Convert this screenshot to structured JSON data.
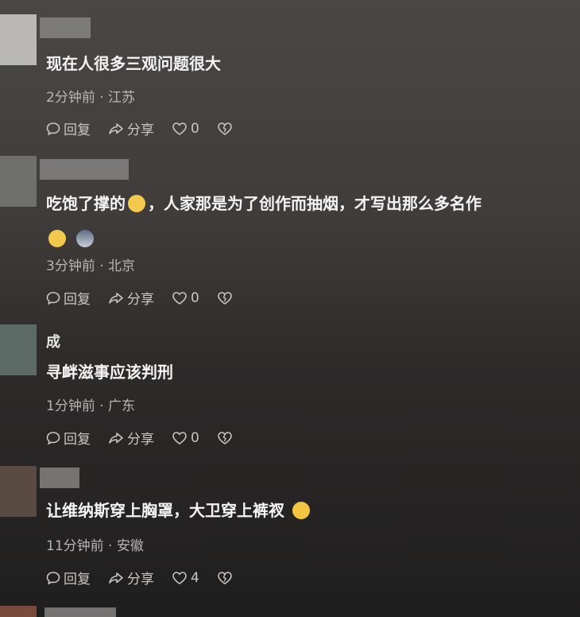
{
  "colors": {
    "background_top": "#4a4744",
    "background_bottom": "#1f1e1e",
    "text": "#f4f4f4",
    "meta": "#b8b6b4"
  },
  "actions": {
    "reply_label": "回复",
    "share_label": "分享"
  },
  "comments": [
    {
      "username": "",
      "text": "现在人很多三观问题很大",
      "time": "2分钟前",
      "location": "江苏",
      "likes": "0"
    },
    {
      "username": "",
      "text_part1": "吃饱了撑的",
      "text_part2": "，人家那是为了创作而抽烟，才写出那么多名作",
      "emoji": [
        "dizzy-face-emoji",
        "crescent-night-emoji"
      ],
      "time": "3分钟前",
      "location": "北京",
      "likes": "0"
    },
    {
      "username": "成",
      "text": "寻衅滋事应该判刑",
      "time": "1分钟前",
      "location": "广东",
      "likes": "0"
    },
    {
      "username": "",
      "text": "让维纳斯穿上胸罩，大卫穿上裤衩",
      "emoji": [
        "laughing-tears-emoji"
      ],
      "time": "11分钟前",
      "location": "安徽",
      "likes": "4"
    }
  ]
}
